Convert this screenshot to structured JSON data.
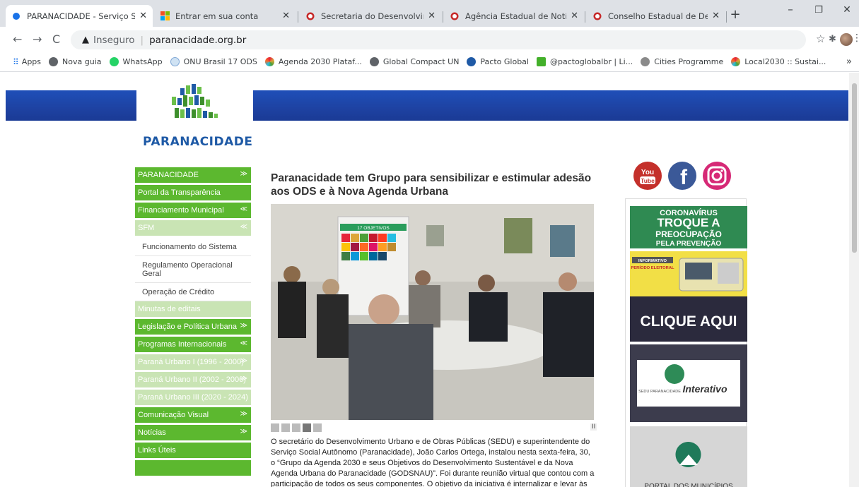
{
  "browser": {
    "tabs": [
      {
        "title": "PARANACIDADE - Serviço Soci",
        "active": true
      },
      {
        "title": "Entrar em sua conta",
        "active": false
      },
      {
        "title": "Secretaria do Desenvolvimento",
        "active": false
      },
      {
        "title": "Agência Estadual de Notícias",
        "active": false
      },
      {
        "title": "Conselho Estadual de Desenvo",
        "active": false
      }
    ],
    "new_tab_symbol": "+",
    "security_label": "Inseguro",
    "url": "paranacidade.org.br",
    "bookmarks": [
      {
        "label": "Apps",
        "icon": "apps-grid-icon"
      },
      {
        "label": "Nova guia",
        "icon": "globe-icon"
      },
      {
        "label": "WhatsApp",
        "icon": "whatsapp-icon"
      },
      {
        "label": "ONU Brasil 17 ODS",
        "icon": "onu-icon"
      },
      {
        "label": "Agenda 2030 Plataf...",
        "icon": "agenda-icon"
      },
      {
        "label": "Global Compact UN",
        "icon": "globe-icon"
      },
      {
        "label": "Pacto Global",
        "icon": "pacto-icon"
      },
      {
        "label": "@pactoglobalbr | Li...",
        "icon": "linktree-icon"
      },
      {
        "label": "Cities Programme",
        "icon": "cities-icon"
      },
      {
        "label": "Local2030 :: Sustai...",
        "icon": "agenda-icon"
      }
    ],
    "bookmarks_overflow": "»"
  },
  "site": {
    "logo_text": "PARANACIDADE",
    "menu": [
      {
        "label": "PARANACIDADE",
        "style": "dark",
        "chevron": "≫"
      },
      {
        "label": "Portal da Transparência",
        "style": "dark",
        "chevron": ""
      },
      {
        "label": "Financiamento Municipal",
        "style": "dark",
        "chevron": "≪"
      },
      {
        "label": "SFM",
        "style": "light",
        "chevron": "≪"
      },
      {
        "label": "Funcionamento do Sistema",
        "style": "sub",
        "chevron": ""
      },
      {
        "label": "Regulamento Operacional Geral",
        "style": "sub2",
        "chevron": ""
      },
      {
        "label": "Operação de Crédito",
        "style": "sub",
        "chevron": ""
      },
      {
        "label": "Minutas de editais",
        "style": "light",
        "chevron": ""
      },
      {
        "label": "Legislação e Política Urbana",
        "style": "dark",
        "chevron": "≫"
      },
      {
        "label": "Programas Internacionais",
        "style": "dark",
        "chevron": "≪"
      },
      {
        "label": "Paraná Urbano I (1996 - 2000)",
        "style": "light",
        "chevron": "≫"
      },
      {
        "label": "Paraná Urbano II (2002 - 2006)",
        "style": "light",
        "chevron": "≫"
      },
      {
        "label": "Paraná Urbano III (2020 - 2024)",
        "style": "light",
        "chevron": ""
      },
      {
        "label": "Comunicação Visual",
        "style": "dark",
        "chevron": "≫"
      },
      {
        "label": "Notícias",
        "style": "dark",
        "chevron": "≫"
      },
      {
        "label": "Links Úteis",
        "style": "dark",
        "chevron": ""
      },
      {
        "label": "",
        "style": "dark",
        "chevron": ""
      }
    ],
    "headline": "Paranacidade tem Grupo para sensibilizar e estimular adesão aos ODS e à Nova Agenda Urbana",
    "photo_banner_text": "17 OBJETIVOS",
    "pause_symbol": "II",
    "article": "O secretário do Desenvolvimento Urbano e de Obras Públicas (SEDU) e superintendente do Serviço Social Autônomo (Paranacidade), João Carlos Ortega, instalou nesta sexta-feira, 30, o “Grupo da Agenda 2030 e seus Objetivos do Desenvolvimento Sustentável e da Nova Agenda Urbana do Paranacidade (GODSNAU)”. Foi durante reunião virtual que contou com a participação de todos os seus componentes. O objetivo da iniciativa é internalizar e levar às",
    "social": {
      "youtube_label_1": "You",
      "youtube_label_2": "Tube"
    },
    "ads": {
      "covid": [
        "CORONAVÍRUS",
        "TROQUE A",
        "PREOCUPAÇÃO",
        "PELA PREVENÇÃO"
      ],
      "eleitoral_tag": "INFORMATIVO",
      "eleitoral_title": "PERÍODO ELEITORAL",
      "clique": "CLIQUE AQUI",
      "interativo_small": "SEDU PARANACIDADE",
      "interativo": "Interativo",
      "portal": "PORTAL DOS MUNICÍPIOS"
    }
  },
  "colors": {
    "menu_dark": "#5cb82f",
    "menu_light": "#c9e4b4",
    "header_blue": "#1e42a2",
    "logo_blue": "#1f5aa6"
  }
}
